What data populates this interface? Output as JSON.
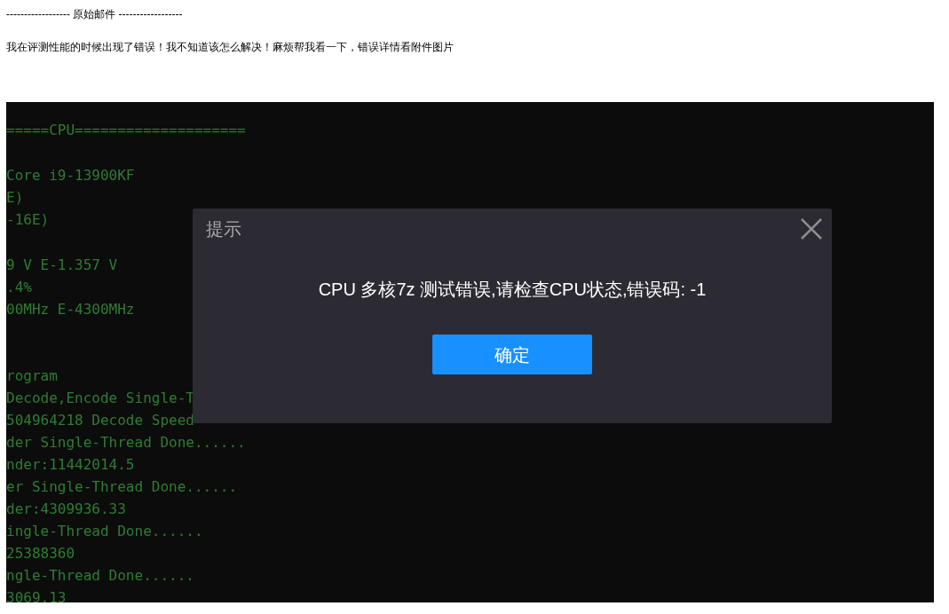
{
  "email": {
    "separator": "------------------ 原始邮件 ------------------",
    "body": "我在评测性能的时候出现了错误！我不知道该怎么解决！麻烦帮我看一下，错误详情看附件图片"
  },
  "attachment": {
    "kind": "screenshot",
    "terminal_blocks": [
      [
        "=====CPU===================="
      ],
      [
        "Core i9-13900KF",
        "E)",
        "-16E)"
      ],
      [
        "9 V E-1.357 V",
        ".4%",
        "00MHz E-4300MHz"
      ],
      [
        "rogram",
        "Decode,Encode Single-T",
        "504964218 Decode Speed",
        "der Single-Thread Done......",
        "nder:11442014.5",
        "er Single-Thread Done......",
        "der:4309936.33",
        "ingle-Thread Done......",
        "25388360",
        "ngle-Thread Done......",
        "3069.13"
      ]
    ],
    "dialog": {
      "title": "提示",
      "message": "CPU 多核7z 测试错误,请检查CPU状态,错误码: -1",
      "confirm": "确定"
    }
  }
}
